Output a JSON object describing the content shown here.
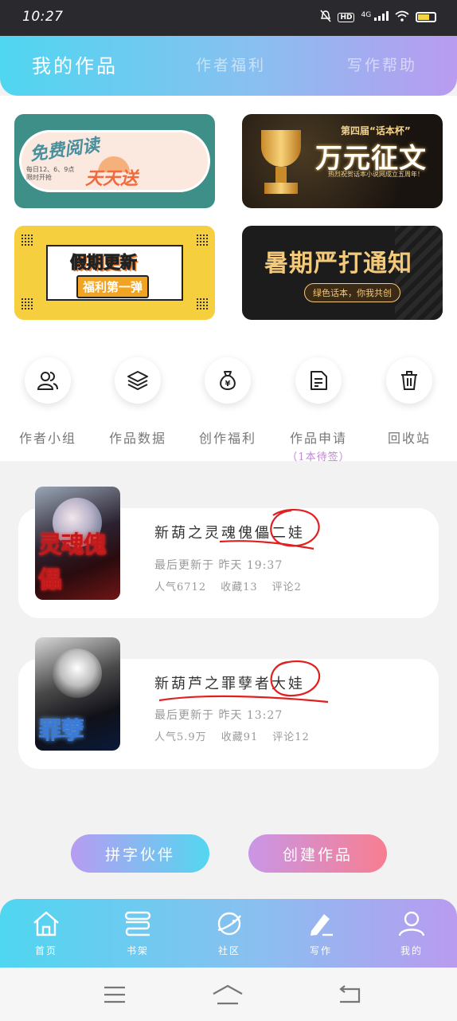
{
  "status_bar": {
    "time": "10:27",
    "network": "4G",
    "hd": "HD"
  },
  "header": {
    "tabs": [
      {
        "label": "我的作品",
        "active": true
      },
      {
        "label": "作者福利",
        "active": false
      },
      {
        "label": "写作帮助",
        "active": false
      }
    ]
  },
  "banners": [
    {
      "title": "免费阅读",
      "subtitle": "天天送",
      "note": "每日12、6、9点 限时开抢"
    },
    {
      "title": "万元征文",
      "subtitle": "第四届“话本杯”",
      "note": "热烈祝贺话本小说网成立五周年！"
    },
    {
      "title": "假期更新",
      "subtitle": "福利第一弹"
    },
    {
      "title": "暑期严打通知",
      "subtitle": "绿色话本，你我共创"
    }
  ],
  "quick_actions": [
    {
      "label": "作者小组",
      "icon": "users-icon"
    },
    {
      "label": "作品数据",
      "icon": "layers-icon"
    },
    {
      "label": "创作福利",
      "icon": "money-bag-icon"
    },
    {
      "label": "作品申请",
      "sub": "（1本待签）",
      "icon": "document-icon"
    },
    {
      "label": "回收站",
      "icon": "trash-icon"
    }
  ],
  "books": [
    {
      "title": "新葫之灵魂傀儡二娃",
      "update": "最后更新于 昨天 19:37",
      "popularity": "人气6712",
      "favorites": "收藏13",
      "comments": "评论2",
      "cover_text": "灵魂傀儡"
    },
    {
      "title": "新葫芦之罪孽者大娃",
      "update": "最后更新于 昨天 13:27",
      "popularity": "人气5.9万",
      "favorites": "收藏91",
      "comments": "评论12",
      "cover_text": "罪孽"
    }
  ],
  "buttons": {
    "partner": "拼字伙伴",
    "create": "创建作品"
  },
  "bottom_nav": [
    {
      "label": "首页",
      "icon": "home-icon"
    },
    {
      "label": "书架",
      "icon": "bookshelf-icon"
    },
    {
      "label": "社区",
      "icon": "planet-icon"
    },
    {
      "label": "写作",
      "icon": "pen-icon"
    },
    {
      "label": "我的",
      "icon": "profile-icon"
    }
  ],
  "colors": {
    "header_gradient_start": "#4fd6f0",
    "header_gradient_end": "#b99bf0",
    "annotation_red": "#e02020",
    "pending_purple": "#c287d4"
  }
}
